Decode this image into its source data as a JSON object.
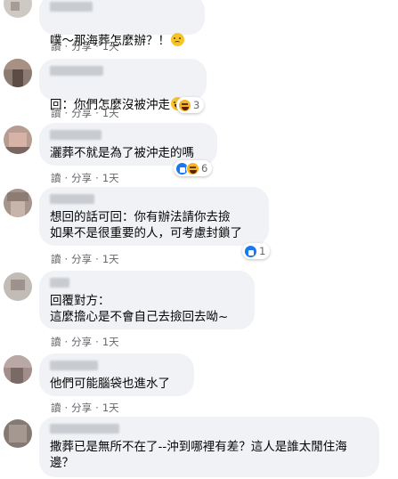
{
  "comments": [
    {
      "text": "噗～那海葬怎麼辦？！",
      "emoji": "worried-face",
      "actions": {
        "read": "讀",
        "share": "分享",
        "time": "1天"
      }
    },
    {
      "text": "回：你們怎麼沒被沖走",
      "emoji": "grinning-face",
      "actions": {
        "read": "讀",
        "share": "分享",
        "time": "1天"
      },
      "reactions": {
        "icons": [
          "haha-icon"
        ],
        "count": "3"
      }
    },
    {
      "text": "灑葬不就是為了被沖走的嗎",
      "actions": {
        "read": "讀",
        "share": "分享",
        "time": "1天"
      },
      "reactions": {
        "icons": [
          "like-icon",
          "haha-icon"
        ],
        "count": "6"
      }
    },
    {
      "text": "想回的話可回：你有辦法請你去撿\n如果不是很重要的人，可考慮封鎖了",
      "actions": {
        "read": "讀",
        "share": "分享",
        "time": "1天"
      },
      "reactions": {
        "icons": [
          "like-icon"
        ],
        "count": "1"
      }
    },
    {
      "text": "回覆對方：\n這麼擔心是不會自己去撿回去呦~",
      "actions": {
        "read": "讀",
        "share": "分享",
        "time": "1天"
      }
    },
    {
      "text": "他們可能腦袋也進水了",
      "actions": {
        "read": "讀",
        "share": "分享",
        "time": "1天"
      }
    },
    {
      "text": "撒葬已是無所不在了--沖到哪裡有差？這人是誰太閒住海\n邊？"
    }
  ],
  "colors": {
    "bubble": "#f0f2f5",
    "action_text": "#65676b",
    "like_blue": "#1877f2",
    "emoji_yellow": "#f7b125"
  }
}
